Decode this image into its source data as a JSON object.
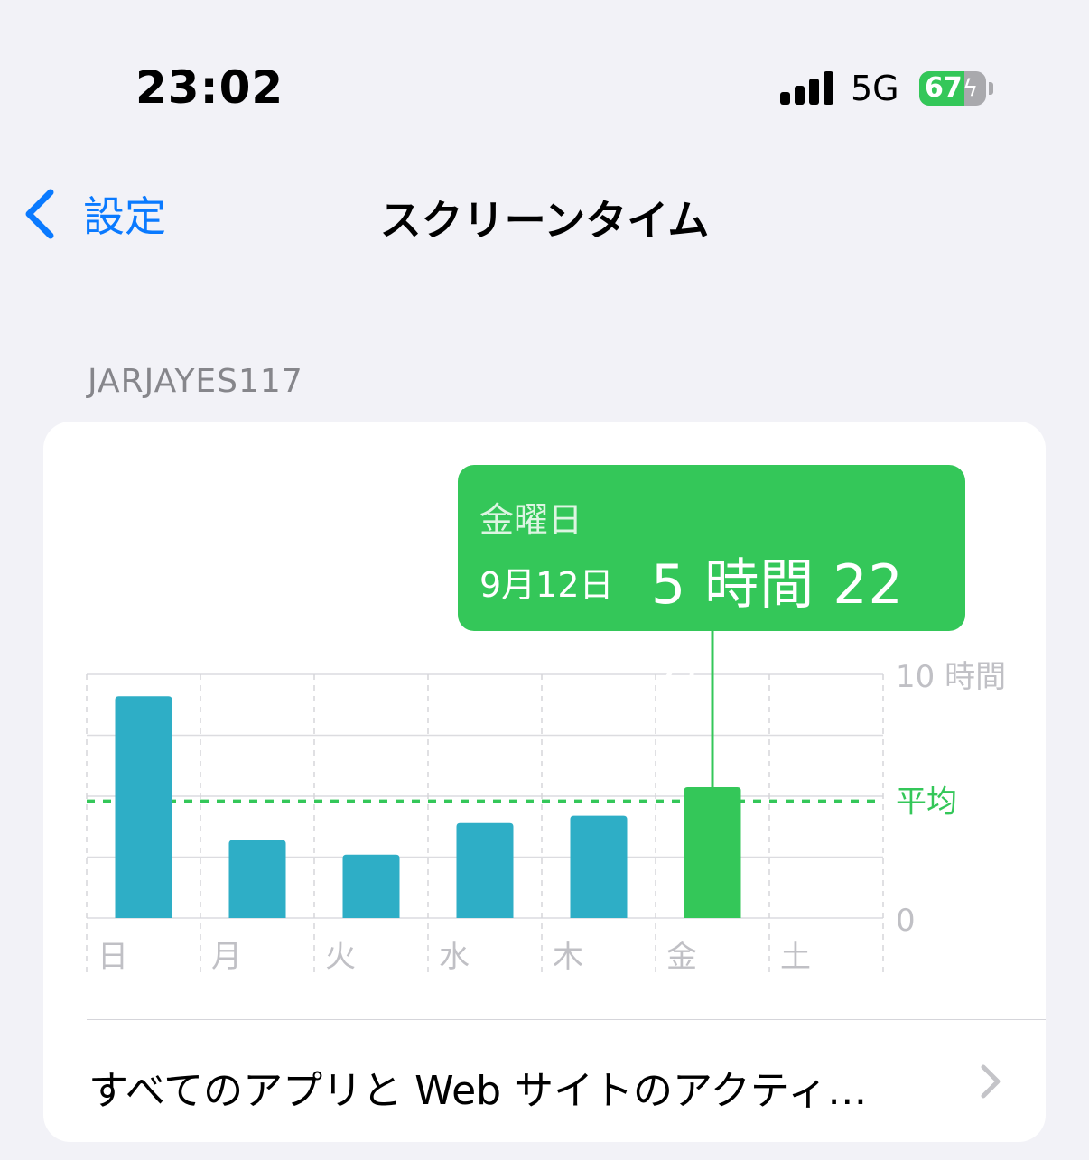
{
  "status_bar": {
    "time": "23:02",
    "network": "5G",
    "battery_level": "67",
    "battery_fraction": 0.67,
    "charging_icon": "bolt-icon"
  },
  "nav": {
    "back_label": "設定",
    "back_icon": "chevron-left-icon",
    "title": "スクリーンタイム"
  },
  "section": {
    "header": "JARJAYES117"
  },
  "tooltip": {
    "weekday": "金曜日",
    "date": "9月12日",
    "value": "5 時間 22 分"
  },
  "activity": {
    "label": "すべてのアプリと Web サイトのアクティ…",
    "chevron_icon": "chevron-right-icon"
  },
  "colors": {
    "accent_blue": "#0a7aff",
    "bar_teal": "#2eaec6",
    "bar_selected_green": "#34c759",
    "axis_label_gray": "#c0c0c5"
  },
  "chart_data": {
    "type": "bar",
    "categories": [
      "日",
      "月",
      "火",
      "水",
      "木",
      "金",
      "土"
    ],
    "values": [
      9.1,
      3.2,
      2.6,
      3.9,
      4.2,
      5.37,
      0
    ],
    "selected_index": 5,
    "average": 4.8,
    "average_label": "平均",
    "ylim": [
      0,
      10
    ],
    "y_tick_labels": [
      "10 時間",
      "0"
    ],
    "grid": true
  }
}
